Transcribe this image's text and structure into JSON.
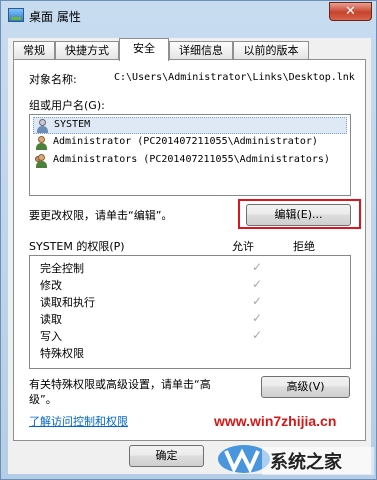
{
  "window": {
    "title": "桌面 属性",
    "close_glyph": "✕"
  },
  "tabs": [
    {
      "label": "常规"
    },
    {
      "label": "快捷方式"
    },
    {
      "label": "安全"
    },
    {
      "label": "详细信息"
    },
    {
      "label": "以前的版本"
    }
  ],
  "object": {
    "label": "对象名称:",
    "value": "C:\\Users\\Administrator\\Links\\Desktop.lnk"
  },
  "groups": {
    "label": "组或用户名(G):",
    "items": [
      {
        "name": "SYSTEM",
        "icon": "system-user-icon"
      },
      {
        "name": "Administrator (PC201407211055\\Administrator)",
        "icon": "user-icon"
      },
      {
        "name": "Administrators (PC201407211055\\Administrators)",
        "icon": "group-icon"
      }
    ]
  },
  "edit": {
    "prompt": "要更改权限，请单击“编辑”。",
    "button": "编辑(E)..."
  },
  "permissions": {
    "header": "SYSTEM 的权限(P)",
    "allow": "允许",
    "deny": "拒绝",
    "rows": [
      {
        "name": "完全控制",
        "allow": true,
        "deny": false
      },
      {
        "name": "修改",
        "allow": true,
        "deny": false
      },
      {
        "name": "读取和执行",
        "allow": true,
        "deny": false
      },
      {
        "name": "读取",
        "allow": true,
        "deny": false
      },
      {
        "name": "写入",
        "allow": true,
        "deny": false
      },
      {
        "name": "特殊权限",
        "allow": false,
        "deny": false
      }
    ],
    "check_glyph": "✓"
  },
  "advanced": {
    "text_line1": "有关特殊权限或高级设置，请单击“高",
    "text_line2": "级”。",
    "button": "高级(V)"
  },
  "help_link": "了解访问控制和权限",
  "footer": {
    "ok": "确定"
  },
  "watermark": {
    "url": "www.win7zhijia.cn",
    "brand": "系统之家"
  },
  "colors": {
    "highlight_box": "#e0141e",
    "link": "#0066cc"
  }
}
